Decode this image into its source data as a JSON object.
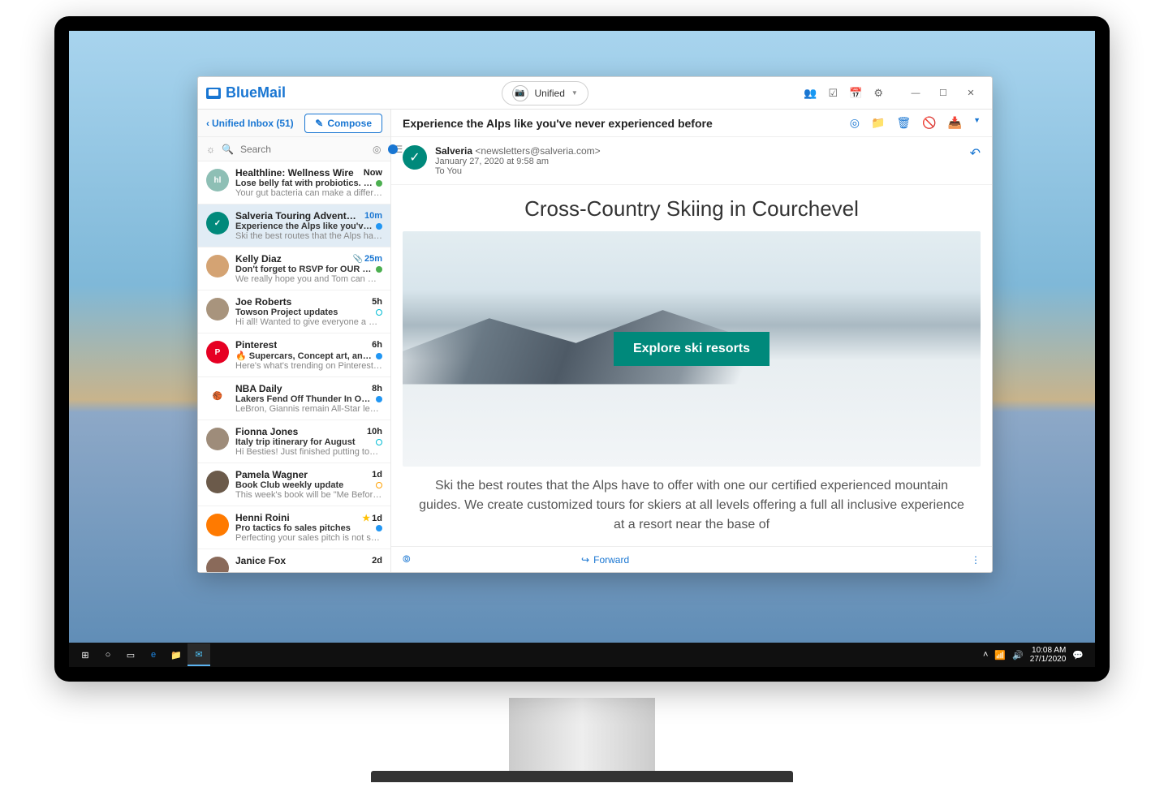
{
  "brand": "BlueMail",
  "unified_label": "Unified",
  "sidebar": {
    "back_label": "Unified Inbox (51)",
    "compose_label": "Compose",
    "search_placeholder": "Search"
  },
  "messages": [
    {
      "sender": "Healthline: Wellness Wire",
      "time": "Now",
      "subject": "Lose belly fat with probiotics. Power walking…",
      "preview": "Your gut bacteria can make a difference in…",
      "dot": "green",
      "avcolor": "#8ebfb5",
      "avtxt": "hl"
    },
    {
      "sender": "Salveria Touring Adventures",
      "time": "10m",
      "subject": "Experience the Alps like you've never experie…",
      "preview": "Ski the best routes that the Alps have to offer…",
      "dot": "blue",
      "avcolor": "#00897b",
      "avtxt": "✓",
      "selected": true,
      "timeblue": true
    },
    {
      "sender": "Kelly Diaz",
      "time": "25m",
      "subject": "Don't forget to RSVP for OUR Wedding!!",
      "preview": "We really hope you and Tom can make it!…",
      "dot": "green",
      "avcolor": "#d4a373",
      "avtxt": "",
      "attach": true,
      "timeblue": true
    },
    {
      "sender": "Joe Roberts",
      "time": "5h",
      "subject": "Towson Project updates",
      "preview": "Hi all! Wanted to give everyone a quick updat…",
      "dot": "teal",
      "avcolor": "#a8947d",
      "avtxt": ""
    },
    {
      "sender": "Pinterest",
      "time": "6h",
      "subject": "🔥 Supercars, Concept art, and more Pins…",
      "preview": "Here's what's trending on Pinterest EQ silver…",
      "dot": "blue",
      "avcolor": "#e60023",
      "avtxt": "P"
    },
    {
      "sender": "NBA Daily",
      "time": "8h",
      "subject": "Lakers Fend Off Thunder In Overtime; Take…",
      "preview": "LeBron, Giannis remain All-Star leaders >>",
      "dot": "blue",
      "avcolor": "#fff",
      "avtxt": "🏀"
    },
    {
      "sender": "Fionna Jones",
      "time": "10h",
      "subject": "Italy trip itinerary for August",
      "preview": "Hi Besties! Just finished putting together an…",
      "dot": "teal",
      "avcolor": "#9e8c7a",
      "avtxt": ""
    },
    {
      "sender": "Pamela Wagner",
      "time": "1d",
      "subject": "Book Club weekly update",
      "preview": "This week's book will be \"Me Before You\" by…",
      "dot": "gold",
      "avcolor": "#6b5a4a",
      "avtxt": ""
    },
    {
      "sender": "Henni Roini",
      "time": "1d",
      "subject": "Pro tactics fo sales pitches",
      "preview": "Perfecting your sales pitch is not something…",
      "dot": "blue",
      "avcolor": "#ff7a00",
      "avtxt": "",
      "star": true
    },
    {
      "sender": "Janice Fox",
      "time": "2d",
      "subject": "",
      "preview": "",
      "dot": "",
      "avcolor": "#8a6a5a",
      "avtxt": ""
    }
  ],
  "pane": {
    "subject": "Experience the Alps like you've never experienced before",
    "from_name": "Salveria",
    "from_email": "<newsletters@salveria.com>",
    "date": "January 27, 2020 at 9:58 am",
    "to": "To You",
    "mail_title": "Cross-Country Skiing in Courchevel",
    "explore_btn": "Explore ski resorts",
    "body_text": "Ski the best routes that the Alps have to offer with one our certified experienced mountain guides. We create customized tours for skiers at all levels offering a full all inclusive experience at a resort near the base of",
    "forward_label": "Forward"
  },
  "taskbar": {
    "time": "10:08 AM",
    "date": "27/1/2020"
  }
}
